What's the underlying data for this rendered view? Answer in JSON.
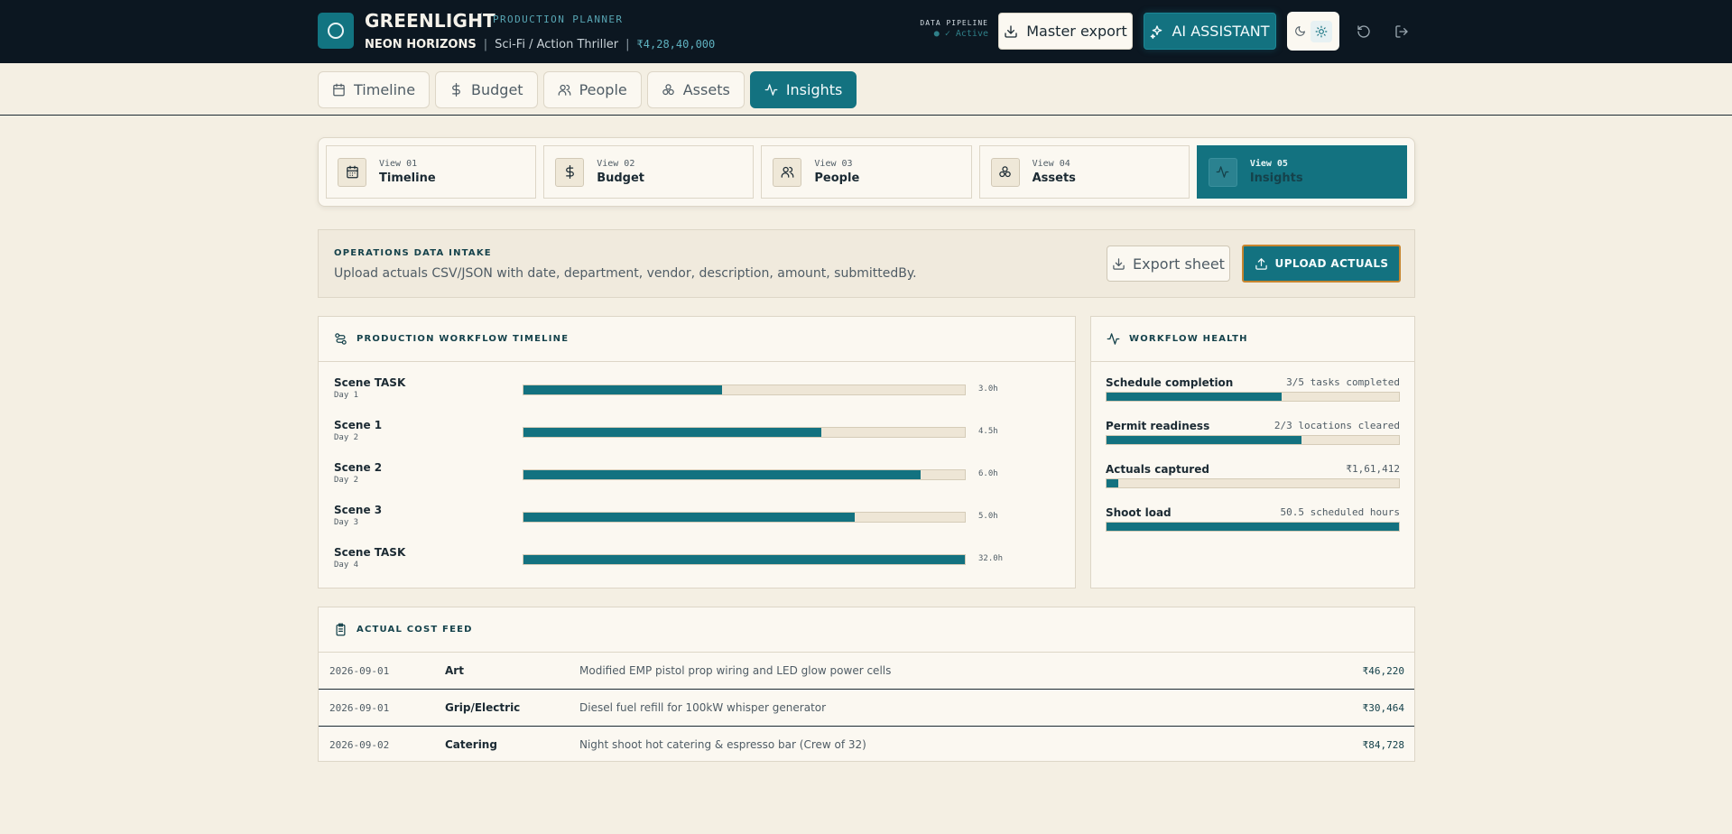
{
  "header": {
    "brand": "GREENLIGHT",
    "subtitle": "PRODUCTION PLANNER",
    "project_name": "NEON HORIZONS",
    "project_genre": "Sci-Fi / Action Thriller",
    "project_budget": "₹4,28,40,000",
    "pipeline_label": "DATA PIPELINE",
    "pipeline_status": "● ✓ Active",
    "master_export_label": "Master export",
    "ai_assistant_label": "AI ASSISTANT"
  },
  "tabs": [
    {
      "label": "Timeline",
      "icon": "calendar-icon"
    },
    {
      "label": "Budget",
      "icon": "dollar-icon"
    },
    {
      "label": "People",
      "icon": "people-icon"
    },
    {
      "label": "Assets",
      "icon": "assets-icon"
    },
    {
      "label": "Insights",
      "icon": "activity-icon",
      "active": true
    }
  ],
  "views": [
    {
      "num": "View 01",
      "name": "Timeline",
      "icon": "calendar-icon"
    },
    {
      "num": "View 02",
      "name": "Budget",
      "icon": "dollar-icon"
    },
    {
      "num": "View 03",
      "name": "People",
      "icon": "people-icon"
    },
    {
      "num": "View 04",
      "name": "Assets",
      "icon": "assets-icon"
    },
    {
      "num": "View 05",
      "name": "Insights",
      "icon": "activity-icon",
      "active": true
    }
  ],
  "intake": {
    "title": "OPERATIONS DATA INTAKE",
    "description": "Upload actuals CSV/JSON with date, department, vendor, description, amount, submittedBy.",
    "export_label": "Export sheet",
    "upload_label": "UPLOAD ACTUALS"
  },
  "workflow": {
    "title": "PRODUCTION WORKFLOW TIMELINE",
    "rows": [
      {
        "label": "Scene TASK",
        "day": "Day 1",
        "value": "3.0h",
        "fill": 0.45
      },
      {
        "label": "Scene 1",
        "day": "Day 2",
        "value": "4.5h",
        "fill": 0.675
      },
      {
        "label": "Scene 2",
        "day": "Day 2",
        "value": "6.0h",
        "fill": 0.9
      },
      {
        "label": "Scene 3",
        "day": "Day 3",
        "value": "5.0h",
        "fill": 0.75
      },
      {
        "label": "Scene TASK",
        "day": "Day 4",
        "value": "32.0h",
        "fill": 1.0
      }
    ]
  },
  "health": {
    "title": "WORKFLOW HEALTH",
    "rows": [
      {
        "label": "Schedule completion",
        "meta": "3/5 tasks completed",
        "fill": 0.6
      },
      {
        "label": "Permit readiness",
        "meta": "2/3 locations cleared",
        "fill": 0.667
      },
      {
        "label": "Actuals captured",
        "meta": "₹1,61,412",
        "fill": 0.04
      },
      {
        "label": "Shoot load",
        "meta": "50.5 scheduled hours",
        "fill": 1.0
      }
    ]
  },
  "cost_feed": {
    "title": "ACTUAL COST FEED",
    "rows": [
      {
        "date": "2026-09-01",
        "dept": "Art",
        "desc": "Modified EMP pistol prop wiring and LED glow power cells",
        "amount": "₹46,220"
      },
      {
        "date": "2026-09-01",
        "dept": "Grip/Electric",
        "desc": "Diesel fuel refill for 100kW whisper generator",
        "amount": "₹30,464"
      },
      {
        "date": "2026-09-02",
        "dept": "Catering",
        "desc": "Night shoot hot catering & espresso bar (Crew of 32)",
        "amount": "₹84,728"
      }
    ]
  },
  "colors": {
    "accent": "#137280",
    "topbar": "#0c1721",
    "background": "#f4efe3",
    "upload_border": "#c7852f"
  }
}
